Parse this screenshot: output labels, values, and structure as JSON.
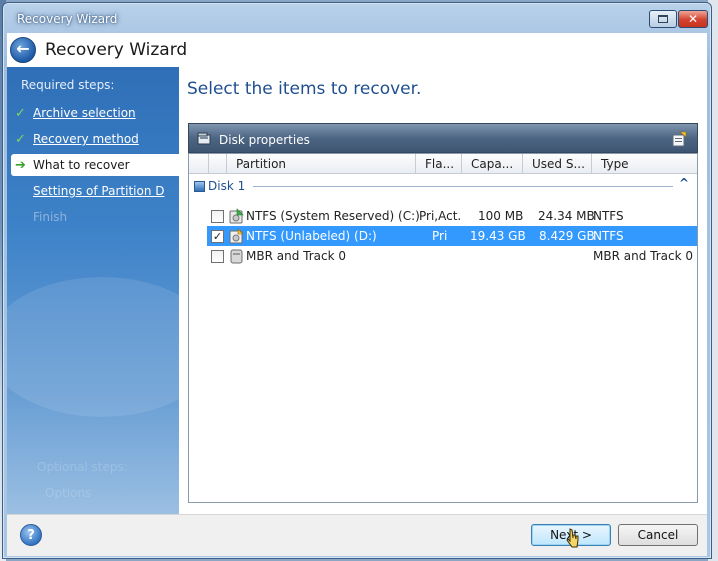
{
  "window": {
    "title": "Recovery Wizard",
    "header_title": "Recovery Wizard"
  },
  "sidebar": {
    "required_label": "Required steps:",
    "steps": [
      {
        "label": "Archive selection",
        "state": "done"
      },
      {
        "label": "Recovery method",
        "state": "done"
      },
      {
        "label": "What to recover",
        "state": "current"
      },
      {
        "label": "Settings of Partition D",
        "state": "todo"
      },
      {
        "label": "Finish",
        "state": "disabled"
      }
    ],
    "faint_1": "Optional steps:",
    "faint_2": "Options"
  },
  "main": {
    "prompt": "Select the items to recover.",
    "disk_properties_label": "Disk properties",
    "columns": [
      "Partition",
      "Fla...",
      "Capa...",
      "Used S...",
      "Type"
    ],
    "disk_group": "Disk 1",
    "rows": [
      {
        "partition": "NTFS (System Reserved) (C:)",
        "flags": "Pri,Act.",
        "capacity": "100 MB",
        "used": "24.34 MB",
        "type": "NTFS",
        "checked": false,
        "selected": false
      },
      {
        "partition": "NTFS (Unlabeled) (D:)",
        "flags": "Pri",
        "capacity": "19.43 GB",
        "used": "8.429 GB",
        "type": "NTFS",
        "checked": true,
        "selected": true
      },
      {
        "partition": "MBR and Track 0",
        "flags": "",
        "capacity": "",
        "used": "",
        "type": "MBR and Track 0",
        "checked": false,
        "selected": false
      }
    ]
  },
  "footer": {
    "next_label": "Next >",
    "cancel_label": "Cancel",
    "help_glyph": "?"
  },
  "icons": {
    "back": "back-arrow-icon",
    "help": "help-icon",
    "checkmark": "green-check-icon",
    "current_step": "arrow-right-icon",
    "partition": "partition-icon",
    "disk": "disk-icon"
  },
  "colors": {
    "selection": "#3399ff",
    "sidebar": "#3d82c8",
    "prompt": "#1f4f8f"
  }
}
